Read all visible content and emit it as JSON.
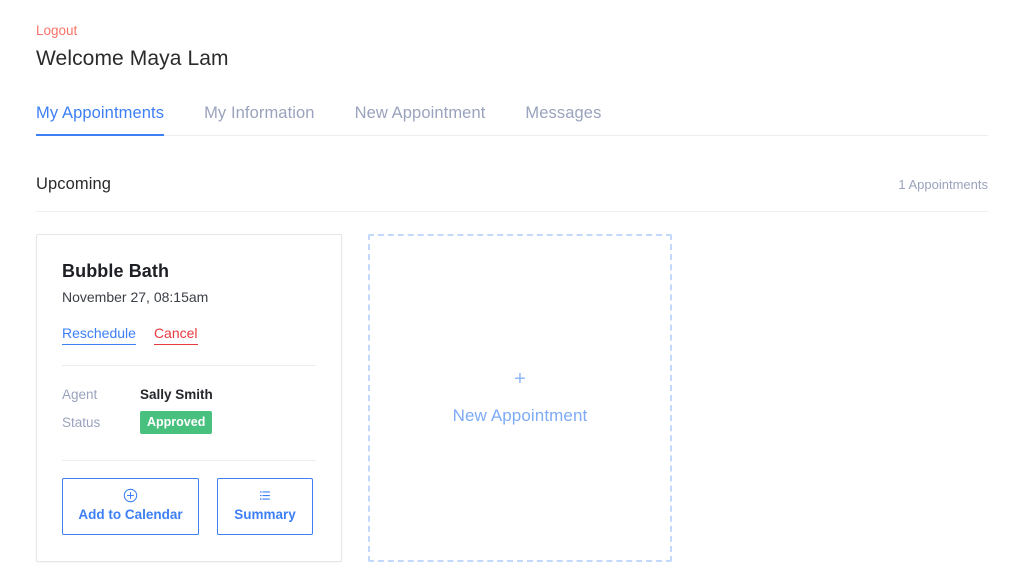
{
  "header": {
    "logout_label": "Logout",
    "welcome_title": "Welcome Maya Lam"
  },
  "tabs": [
    {
      "label": "My Appointments",
      "active": true
    },
    {
      "label": "My Information",
      "active": false
    },
    {
      "label": "New Appointment",
      "active": false
    },
    {
      "label": "Messages",
      "active": false
    }
  ],
  "section": {
    "title": "Upcoming",
    "count_label": "1 Appointments"
  },
  "appointment": {
    "title": "Bubble Bath",
    "datetime": "November 27, 08:15am",
    "reschedule_label": "Reschedule",
    "cancel_label": "Cancel",
    "details": [
      {
        "label": "Agent",
        "value": "Sally Smith",
        "type": "text"
      },
      {
        "label": "Status",
        "value": "Approved",
        "type": "badge"
      }
    ],
    "buttons": [
      {
        "icon": "plus-circle-icon",
        "label": "Add to Calendar"
      },
      {
        "icon": "list-icon",
        "label": "Summary"
      }
    ]
  },
  "new_appointment_card": {
    "plus_glyph": "+",
    "label": "New Appointment"
  },
  "colors": {
    "accent_blue": "#3d7ff5",
    "logout_coral": "#fa7268",
    "cancel_red": "#e83a3f",
    "status_green": "#48c07e",
    "muted_blue_gray": "#9aa3bd",
    "dashed_border_blue": "#c3d9fb"
  }
}
